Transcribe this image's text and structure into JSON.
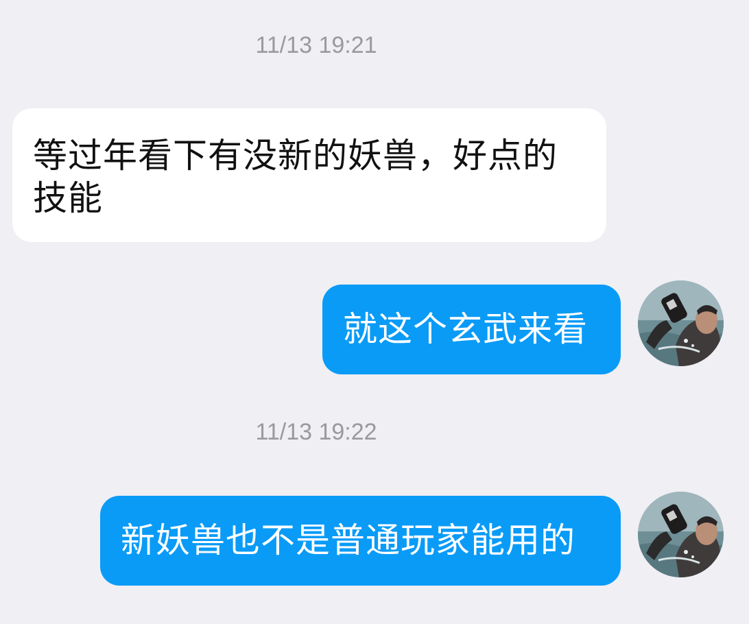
{
  "chat": {
    "messages": [
      {
        "type": "timestamp",
        "text": "11/13 19:21"
      },
      {
        "type": "incoming",
        "text": "等过年看下有没新的妖兽，好点的技能"
      },
      {
        "type": "outgoing",
        "text": "就这个玄武来看",
        "avatar_icon": "user-avatar-icon"
      },
      {
        "type": "timestamp",
        "text": "11/13 19:22"
      },
      {
        "type": "outgoing",
        "text": "新妖兽也不是普通玩家能用的",
        "avatar_icon": "user-avatar-icon"
      }
    ]
  },
  "colors": {
    "background": "#efeff4",
    "incoming_bubble": "#ffffff",
    "outgoing_bubble": "#0a9bf7",
    "timestamp_text": "#9a9a9a"
  }
}
